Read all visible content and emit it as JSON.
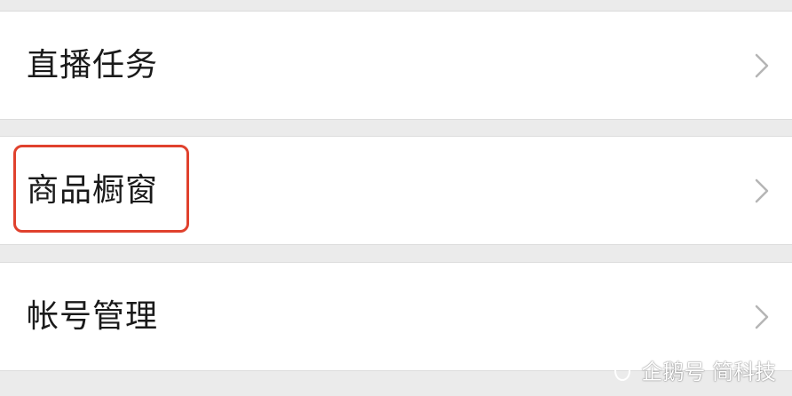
{
  "menu": {
    "items": [
      {
        "label": "直播任务",
        "icon": "chevron-right-icon",
        "highlighted": false
      },
      {
        "label": "商品橱窗",
        "icon": "chevron-right-icon",
        "highlighted": true
      },
      {
        "label": "帐号管理",
        "icon": "chevron-right-icon",
        "highlighted": false
      }
    ]
  },
  "highlight": {
    "color": "#e0412d"
  },
  "watermark": {
    "icon": "penguin-icon",
    "text": "企鹅号 简科技"
  },
  "colors": {
    "background": "#ebebeb",
    "row_background": "#ffffff",
    "text": "#1a1a1a",
    "chevron": "#b5b5b5"
  }
}
